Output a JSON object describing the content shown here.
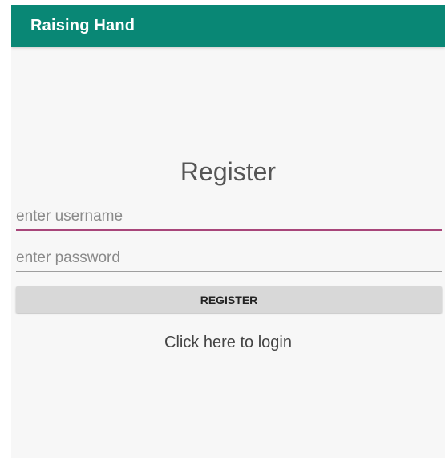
{
  "app_bar": {
    "title": "Raising Hand",
    "background_color": "#098775"
  },
  "main": {
    "heading": "Register",
    "username_field": {
      "placeholder": "enter username",
      "value": "",
      "underline_color": "#a8467a"
    },
    "password_field": {
      "placeholder": "enter password",
      "value": ""
    },
    "register_button_label": "REGISTER",
    "login_link_text": "Click here to login"
  }
}
